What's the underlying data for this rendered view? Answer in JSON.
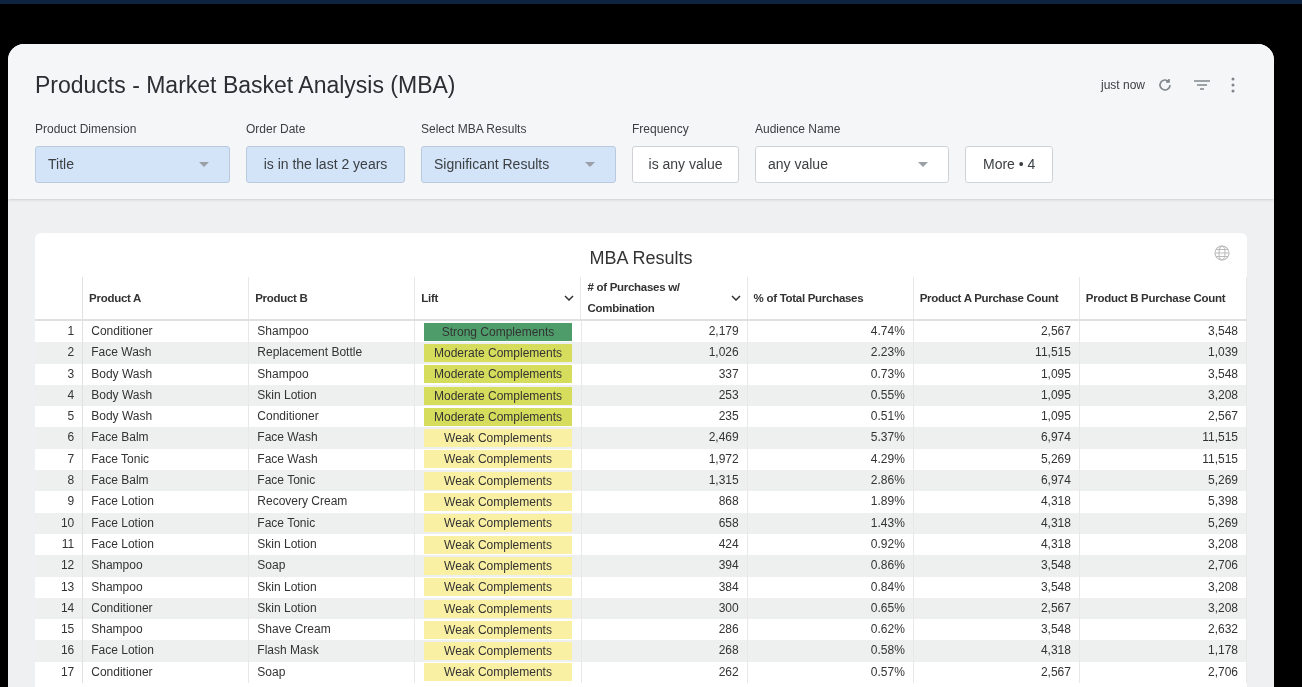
{
  "dashboard": {
    "title": "Products - Market Basket Analysis (MBA)",
    "updated": "just now"
  },
  "filters": [
    {
      "label": "Product Dimension",
      "value": "Title",
      "kind": "dropdown",
      "active": true
    },
    {
      "label": "Order Date",
      "value": "is in the last 2 years",
      "kind": "plain",
      "active": true
    },
    {
      "label": "Select MBA Results",
      "value": "Significant Results",
      "kind": "dropdown",
      "active": true
    },
    {
      "label": "Frequency",
      "value": "is any value",
      "kind": "plain",
      "active": false
    },
    {
      "label": "Audience Name",
      "value": "any value",
      "kind": "dropdown",
      "active": false
    }
  ],
  "more_button": "More • 4",
  "table": {
    "title": "MBA Results",
    "columns": [
      {
        "label": "Product A",
        "sorted": false
      },
      {
        "label": "Product B",
        "sorted": false
      },
      {
        "label": "Lift",
        "sorted": true
      },
      {
        "label": "# of Purchases w/ Combination",
        "sorted": true
      },
      {
        "label": "% of Total Purchases",
        "sorted": false
      },
      {
        "label": "Product A Purchase Count",
        "sorted": false
      },
      {
        "label": "Product B Purchase Count",
        "sorted": false
      }
    ],
    "rows": [
      {
        "index": "1",
        "cells": [
          "Conditioner",
          "Shampoo",
          "Strong Complements",
          "2,179",
          "4.74%",
          "2,567",
          "3,548"
        ],
        "color": "#4e9c6a"
      },
      {
        "index": "2",
        "cells": [
          "Face Wash",
          "Replacement Bottle",
          "Moderate Complements",
          "1,026",
          "2.23%",
          "11,515",
          "1,039"
        ],
        "color": "#d6dd5c"
      },
      {
        "index": "3",
        "cells": [
          "Body Wash",
          "Shampoo",
          "Moderate Complements",
          "337",
          "0.73%",
          "1,095",
          "3,548"
        ],
        "color": "#d6dd5c"
      },
      {
        "index": "4",
        "cells": [
          "Body Wash",
          "Skin Lotion",
          "Moderate Complements",
          "253",
          "0.55%",
          "1,095",
          "3,208"
        ],
        "color": "#d6dd5c"
      },
      {
        "index": "5",
        "cells": [
          "Body Wash",
          "Conditioner",
          "Moderate Complements",
          "235",
          "0.51%",
          "1,095",
          "2,567"
        ],
        "color": "#d6dd5c"
      },
      {
        "index": "6",
        "cells": [
          "Face Balm",
          "Face Wash",
          "Weak Complements",
          "2,469",
          "5.37%",
          "6,974",
          "11,515"
        ],
        "color": "#faf0a4"
      },
      {
        "index": "7",
        "cells": [
          "Face Tonic",
          "Face Wash",
          "Weak Complements",
          "1,972",
          "4.29%",
          "5,269",
          "11,515"
        ],
        "color": "#faf0a4"
      },
      {
        "index": "8",
        "cells": [
          "Face Balm",
          "Face Tonic",
          "Weak Complements",
          "1,315",
          "2.86%",
          "6,974",
          "5,269"
        ],
        "color": "#faf0a4"
      },
      {
        "index": "9",
        "cells": [
          "Face Lotion",
          "Recovery Cream",
          "Weak Complements",
          "868",
          "1.89%",
          "4,318",
          "5,398"
        ],
        "color": "#faf0a4"
      },
      {
        "index": "10",
        "cells": [
          "Face Lotion",
          "Face Tonic",
          "Weak Complements",
          "658",
          "1.43%",
          "4,318",
          "5,269"
        ],
        "color": "#faf0a4"
      },
      {
        "index": "11",
        "cells": [
          "Face Lotion",
          "Skin Lotion",
          "Weak Complements",
          "424",
          "0.92%",
          "4,318",
          "3,208"
        ],
        "color": "#faf0a4"
      },
      {
        "index": "12",
        "cells": [
          "Shampoo",
          "Soap",
          "Weak Complements",
          "394",
          "0.86%",
          "3,548",
          "2,706"
        ],
        "color": "#faf0a4"
      },
      {
        "index": "13",
        "cells": [
          "Shampoo",
          "Skin Lotion",
          "Weak Complements",
          "384",
          "0.84%",
          "3,548",
          "3,208"
        ],
        "color": "#faf0a4"
      },
      {
        "index": "14",
        "cells": [
          "Conditioner",
          "Skin Lotion",
          "Weak Complements",
          "300",
          "0.65%",
          "2,567",
          "3,208"
        ],
        "color": "#faf0a4"
      },
      {
        "index": "15",
        "cells": [
          "Shampoo",
          "Shave Cream",
          "Weak Complements",
          "286",
          "0.62%",
          "3,548",
          "2,632"
        ],
        "color": "#faf0a4"
      },
      {
        "index": "16",
        "cells": [
          "Face Lotion",
          "Flash Mask",
          "Weak Complements",
          "268",
          "0.58%",
          "4,318",
          "1,178"
        ],
        "color": "#faf0a4"
      },
      {
        "index": "17",
        "cells": [
          "Conditioner",
          "Soap",
          "Weak Complements",
          "262",
          "0.57%",
          "2,567",
          "2,706"
        ],
        "color": "#faf0a4"
      }
    ]
  }
}
